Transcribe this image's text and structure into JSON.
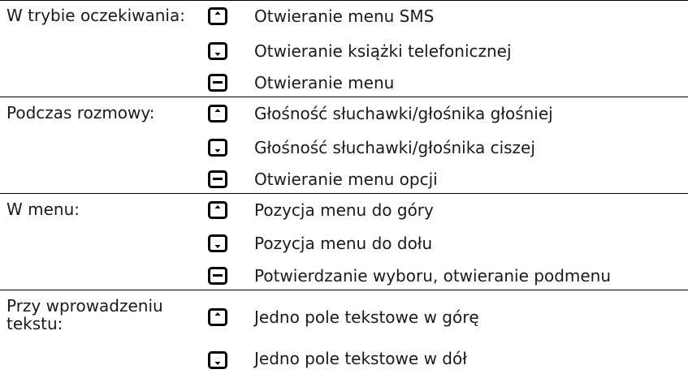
{
  "sections": [
    {
      "context": "W trybie oczekiwania:",
      "items": [
        {
          "key_icon": "arrow-up-key-icon",
          "action": "Otwieranie menu SMS"
        },
        {
          "key_icon": "arrow-down-key-icon",
          "action": "Otwieranie książki telefonicznej"
        },
        {
          "key_icon": "menu-key-icon",
          "action": "Otwieranie menu"
        }
      ]
    },
    {
      "context": "Podczas rozmowy:",
      "items": [
        {
          "key_icon": "arrow-up-key-icon",
          "action": "Głośność słuchawki/głośnika głośniej"
        },
        {
          "key_icon": "arrow-down-key-icon",
          "action": "Głośność słuchawki/głośnika ciszej"
        },
        {
          "key_icon": "menu-key-icon",
          "action": "Otwieranie menu opcji"
        }
      ]
    },
    {
      "context": "W menu:",
      "items": [
        {
          "key_icon": "arrow-up-key-icon",
          "action": "Pozycja menu do góry"
        },
        {
          "key_icon": "arrow-down-key-icon",
          "action": "Pozycja menu do dołu"
        },
        {
          "key_icon": "menu-key-icon",
          "action": "Potwierdzanie wyboru, otwieranie podmenu"
        }
      ]
    },
    {
      "context": "Przy wprowadzeniu tekstu:",
      "items": [
        {
          "key_icon": "arrow-up-key-icon",
          "action": "Jedno pole tekstowe w górę"
        },
        {
          "key_icon": "arrow-down-key-icon",
          "action": "Jedno pole tekstowe w dół"
        }
      ]
    }
  ]
}
